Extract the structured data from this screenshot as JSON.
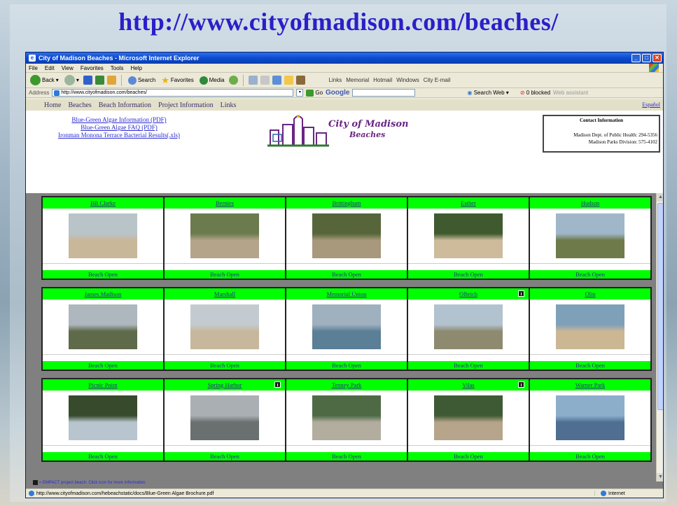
{
  "slide_title": "http://www.cityofmadison.com/beaches/",
  "window": {
    "title": "City of Madison Beaches - Microsoft Internet Explorer",
    "menu": [
      "File",
      "Edit",
      "View",
      "Favorites",
      "Tools",
      "Help"
    ],
    "toolbar": {
      "back": "Back",
      "search": "Search",
      "favorites": "Favorites",
      "media": "Media",
      "links_label": "Links",
      "links": [
        "Memorial",
        "Hotmail",
        "Windows",
        "City E-mail"
      ]
    },
    "address": {
      "label": "Address",
      "url": "http://www.cityofmadison.com/beaches/",
      "go": "Go",
      "google": "Google",
      "search_web": "Search Web",
      "blocked": "0 blocked",
      "web_assistant": "Web assistant"
    },
    "status": {
      "url": "http://www.cityofmadison.com/hebeachstatic/docs/Blue-Green Algae Brochure.pdf",
      "zone": "Internet"
    }
  },
  "page": {
    "nav": [
      "Home",
      "Beaches",
      "Beach Information",
      "Project Information",
      "Links"
    ],
    "espanol": "Español",
    "pdf_links": [
      "Blue-Green Algae Information (PDF)",
      "Blue-Green Algae FAQ (PDF)",
      "Ironman Monona Terrace Bacterial Results(.xls)"
    ],
    "logo": {
      "line1": "City of Madison",
      "line2": "Beaches"
    },
    "contact": {
      "title": "Contact Information",
      "line1": "Madison Dept. of Public Health: 294-5356",
      "line2": "Madison Parks Division: 575-4102"
    },
    "groups": [
      [
        {
          "name": "BB Clarke",
          "status": "Beach Open",
          "empact": false,
          "sky": "#b9c4c9",
          "ground": "#c9b79a"
        },
        {
          "name": "Bernies",
          "status": "Beach Open",
          "empact": false,
          "sky": "#6b7b4d",
          "ground": "#b4a48a"
        },
        {
          "name": "Brittingham",
          "status": "Beach Open",
          "empact": false,
          "sky": "#56663a",
          "ground": "#a8987c"
        },
        {
          "name": "Esther",
          "status": "Beach Open",
          "empact": false,
          "sky": "#3f5a2f",
          "ground": "#cdbb9b"
        },
        {
          "name": "Hudson",
          "status": "Beach Open",
          "empact": false,
          "sky": "#9fb7c9",
          "ground": "#6f7a4a"
        }
      ],
      [
        {
          "name": "James Madison",
          "status": "Beach Open",
          "empact": false,
          "sky": "#aeb7bd",
          "ground": "#5e6a4a"
        },
        {
          "name": "Marshall",
          "status": "Beach Open",
          "empact": false,
          "sky": "#c4cbd0",
          "ground": "#c7b79c"
        },
        {
          "name": "Memorial Union",
          "status": "Beach Open",
          "empact": false,
          "sky": "#9fb0bf",
          "ground": "#5a7f97"
        },
        {
          "name": "Olbrich",
          "status": "Beach Open",
          "empact": true,
          "sky": "#b3c2cf",
          "ground": "#8d8a6f"
        },
        {
          "name": "Olin",
          "status": "Beach Open",
          "empact": false,
          "sky": "#7fa0b9",
          "ground": "#cbb794"
        }
      ],
      [
        {
          "name": "Picnic Point",
          "status": "Beach Open",
          "empact": false,
          "sky": "#374a2c",
          "ground": "#b8c4ce"
        },
        {
          "name": "Spring Harbor",
          "status": "Beach Open",
          "empact": true,
          "sky": "#a9afb3",
          "ground": "#6a6f6f"
        },
        {
          "name": "Tenney Park",
          "status": "Beach Open",
          "empact": false,
          "sky": "#4d6a45",
          "ground": "#b3ada0"
        },
        {
          "name": "Vilas",
          "status": "Beach Open",
          "empact": true,
          "sky": "#3e5a35",
          "ground": "#b6a58a"
        },
        {
          "name": "Warner Park",
          "status": "Beach Open",
          "empact": false,
          "sky": "#8caecb",
          "ground": "#4f6e92"
        }
      ]
    ],
    "footer_note": "= EMPACT project beach. Click icon for more information."
  }
}
